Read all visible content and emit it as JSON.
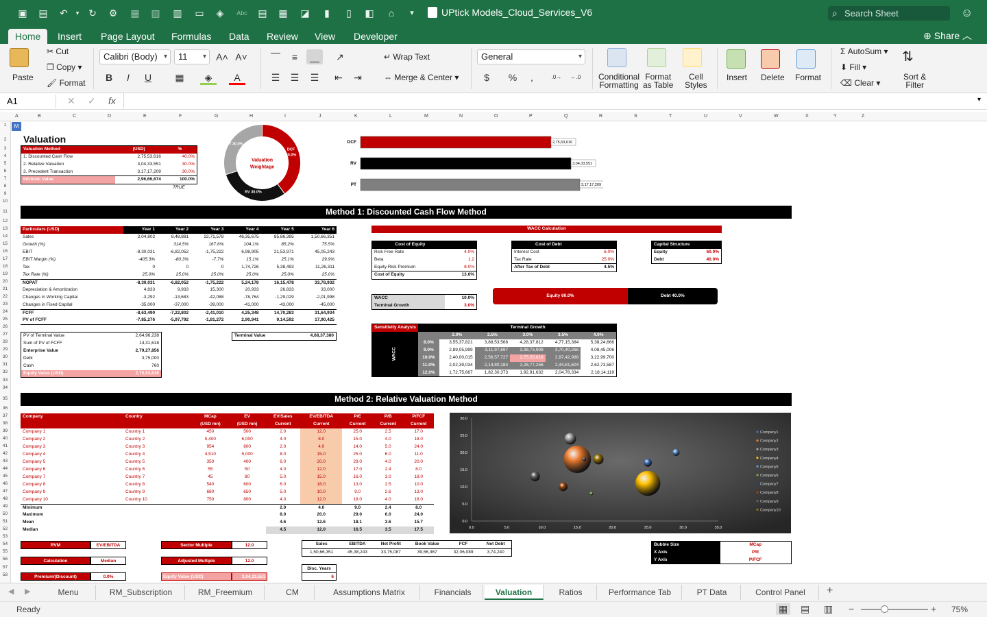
{
  "app": {
    "title": "UPtick Models_Cloud_Services_V6",
    "search_placeholder": "Search Sheet",
    "share": "Share",
    "tabs": [
      "Home",
      "Insert",
      "Page Layout",
      "Formulas",
      "Data",
      "Review",
      "View",
      "Developer"
    ]
  },
  "ribbon": {
    "paste": "Paste",
    "cut": "Cut",
    "copy": "Copy",
    "format": "Format",
    "font": "Calibri (Body)",
    "size": "11",
    "bold": "B",
    "italic": "I",
    "underline": "U",
    "wrap": "Wrap Text",
    "merge": "Merge & Center",
    "numfmt": "General",
    "percent": "%",
    "cond": [
      "Conditional",
      "Formatting"
    ],
    "fmt_table": [
      "Format",
      "as Table"
    ],
    "cell_styles": [
      "Cell",
      "Styles"
    ],
    "insert": "Insert",
    "delete": "Delete",
    "format_cells": "Format",
    "autosum": "AutoSum",
    "fill": "Fill",
    "clear": "Clear",
    "sort": [
      "Sort &",
      "Filter"
    ]
  },
  "formula": {
    "cell": "A1",
    "fx": "fx"
  },
  "columns": [
    "A",
    "B",
    "C",
    "D",
    "E",
    "F",
    "G",
    "H",
    "I",
    "J",
    "K",
    "L",
    "M",
    "N",
    "O",
    "P",
    "Q",
    "R",
    "S",
    "T",
    "U",
    "V",
    "W",
    "X",
    "Y",
    "Z"
  ],
  "valuation": {
    "title": "Valuation",
    "header": [
      "Valuation Method",
      "(USD)",
      "%"
    ],
    "rows": [
      [
        "1. Discounted Cash Flow",
        "2,75,53,616",
        "40.0%"
      ],
      [
        "2. Relative Valuation",
        "3,04,33,551",
        "30.0%"
      ],
      [
        "3. Precedent Transaction",
        "3,17,17,209",
        "30.0%"
      ]
    ],
    "total": [
      "Intrinsic Value",
      "2,96,66,674",
      "100.0%"
    ],
    "check": "TRUE"
  },
  "donut": {
    "center": [
      "Valuation",
      "Weightage"
    ],
    "labels": [
      "DCF",
      "40.0%",
      "RV 30.0%",
      "PT 30.0%"
    ],
    "colors": [
      "#c00000",
      "#111111",
      "#a6a6a6"
    ],
    "values": [
      40,
      30,
      30
    ]
  },
  "bars": {
    "items": [
      {
        "name": "DCF",
        "value": 27553616,
        "label": "2,75,53,616",
        "color": "#c00000"
      },
      {
        "name": "RV",
        "value": 30433551,
        "label": "3,04,33,551",
        "color": "#000000"
      },
      {
        "name": "PT",
        "value": 31717209,
        "label": "3,17,17,209",
        "color": "#7f7f7f"
      }
    ],
    "max": 31717209
  },
  "m1": {
    "title": "Method 1: Discounted Cash Flow Method",
    "head": [
      "Particulars (USD)",
      "Year 1",
      "Year 2",
      "Year 3",
      "Year 4",
      "Year 5",
      "Year 6"
    ],
    "rows": [
      [
        "Sales",
        "2,04,802",
        "8,48,881",
        "22,71,578",
        "46,35,675",
        "85,86,395",
        "1,50,66,351"
      ],
      [
        "Growth (%)",
        "",
        "314.5%",
        "167.6%",
        "104.1%",
        "85.2%",
        "75.5%"
      ],
      [
        "EBIT",
        "-8,30,031",
        "-6,82,052",
        "-1,75,222",
        "6,98,905",
        "21,53,971",
        "45,05,243"
      ],
      [
        "EBIT Margin (%)",
        "-405.3%",
        "-80.3%",
        "-7.7%",
        "15.1%",
        "25.1%",
        "29.9%"
      ],
      [
        "Tax",
        "0",
        "0",
        "0",
        "1,74,726",
        "5,38,493",
        "11,26,311"
      ],
      [
        "Tax Rate (%)",
        "25.0%",
        "25.0%",
        "25.0%",
        "25.0%",
        "25.0%",
        "25.0%"
      ],
      [
        "NOPAT",
        "-8,30,031",
        "-6,82,052",
        "-1,75,222",
        "5,24,178",
        "16,15,478",
        "33,78,932"
      ],
      [
        "Depreciation & Amortization",
        "4,833",
        "9,933",
        "15,300",
        "20,933",
        "26,833",
        "33,000"
      ],
      [
        "Changes in Working Capital",
        "-3,292",
        "-13,683",
        "-42,088",
        "-78,764",
        "-1,29,029",
        "-2,01,998"
      ],
      [
        "Changes in Fixed Capital",
        "-35,000",
        "-37,000",
        "-39,000",
        "-41,000",
        "-43,000",
        "-45,000"
      ],
      [
        "FCFF",
        "-8,63,490",
        "-7,22,802",
        "-2,41,010",
        "4,25,348",
        "14,70,283",
        "31,64,934"
      ],
      [
        "PV of FCFF",
        "-7,85,276",
        "-5,97,792",
        "-1,81,272",
        "2,90,941",
        "9,14,592",
        "17,90,425"
      ]
    ],
    "summary": [
      [
        "PV of Terminal Value",
        "2,64,96,238"
      ],
      [
        "Sum of PV of FCFF",
        "14,31,618"
      ],
      [
        "Enterprise Value",
        "2,79,27,856"
      ],
      [
        "Debt",
        "3,75,000"
      ],
      [
        "Cash",
        "760"
      ],
      [
        "Equity Value (USD)",
        "2,75,53,616"
      ]
    ],
    "terminal": [
      "Terminal Value",
      "4,68,37,380"
    ],
    "wacc_title": "WACC Calculation",
    "coe": {
      "head": "Cost of Equity",
      "rows": [
        [
          "Risk Free Rate",
          "4.0%"
        ],
        [
          "Beta",
          "1.2"
        ],
        [
          "Equity Risk Premium",
          "8.0%"
        ]
      ],
      "total": [
        "Cost of Equity",
        "13.6%"
      ]
    },
    "cod": {
      "head": "Cost of Debt",
      "rows": [
        [
          "Interest Cost",
          "6.0%"
        ],
        [
          "Tax Rate",
          "25.0%"
        ]
      ],
      "total": [
        "After Tax of Debt",
        "4.5%"
      ]
    },
    "cap": {
      "head": "Capital Structure",
      "rows": [
        [
          "Equity",
          "60.0%"
        ],
        [
          "Debt",
          "40.0%"
        ]
      ]
    },
    "wacc": [
      [
        "WACC",
        "10.0%"
      ],
      [
        "Terminal Growth",
        "3.0%"
      ]
    ],
    "equity_bar": {
      "equity_label": "Equity 60.0%",
      "debt_label": "Debt 40.0%",
      "equity": 60
    },
    "sens": {
      "title": "Sensitivity Analysis",
      "tg": "Terminal Growth",
      "wacc": "WACC",
      "cols": [
        "2.0%",
        "2.5%",
        "3.0%",
        "3.5%",
        "4.0%"
      ],
      "rows": [
        [
          "8.0%",
          "3,55,37,821",
          "3,88,53,568",
          "4,28,37,812",
          "4,77,15,384",
          "5,38,24,666"
        ],
        [
          "9.0%",
          "2,89,05,999",
          "3,11,97,697",
          "3,38,73,908",
          "3,70,40,268",
          "4,08,45,006"
        ],
        [
          "10.0%",
          "2,40,00,015",
          "2,56,57,727",
          "2,75,53,616",
          "2,97,42,986",
          "3,22,99,700"
        ],
        [
          "11.0%",
          "2,02,39,034",
          "2,14,80,184",
          "2,28,77,256",
          "2,44,61,604",
          "2,62,73,587"
        ],
        [
          "12.0%",
          "1,72,75,667",
          "1,82,30,373",
          "1,92,91,632",
          "2,04,78,334",
          "2,18,14,119"
        ]
      ]
    }
  },
  "m2": {
    "title": "Method 2: Relative Valuation Method",
    "head": [
      "Company",
      "Country",
      "MCap",
      "EV",
      "EV/Sales",
      "EV/EBITDA",
      "P/E",
      "P/B",
      "P/FCF"
    ],
    "sub": [
      "",
      "",
      "(USD mn)",
      "(USD mn)",
      "Current",
      "Current",
      "Current",
      "Current",
      "Current"
    ],
    "rows": [
      [
        "Company 1",
        "Country 1",
        "450",
        "500",
        "2.0",
        "12.0",
        "25.0",
        "2.5",
        "17.0"
      ],
      [
        "Company 2",
        "Country 2",
        "5,400",
        "6,000",
        "4.0",
        "8.0",
        "15.0",
        "4.0",
        "18.0"
      ],
      [
        "Company 3",
        "Country 3",
        "954",
        "800",
        "2.0",
        "4.0",
        "14.0",
        "5.0",
        "24.0"
      ],
      [
        "Company 4",
        "Country 4",
        "4,510",
        "5,000",
        "8.0",
        "15.0",
        "25.0",
        "6.0",
        "11.0"
      ],
      [
        "Company 5",
        "Country 5",
        "350",
        "400",
        "6.0",
        "20.0",
        "29.0",
        "4.0",
        "20.0"
      ],
      [
        "Company 6",
        "Country 6",
        "55",
        "50",
        "4.0",
        "12.0",
        "17.0",
        "2.4",
        "8.0"
      ],
      [
        "Company 7",
        "Country 7",
        "45",
        "80",
        "5.0",
        "15.0",
        "16.0",
        "3.0",
        "18.0"
      ],
      [
        "Company 8",
        "Country 8",
        "540",
        "600",
        "6.0",
        "18.0",
        "13.0",
        "2.5",
        "10.0"
      ],
      [
        "Company 9",
        "Country 9",
        "680",
        "650",
        "5.0",
        "10.0",
        "9.0",
        "2.6",
        "13.0"
      ],
      [
        "Company 10",
        "Country 10",
        "750",
        "800",
        "4.0",
        "12.0",
        "18.0",
        "4.0",
        "18.0"
      ]
    ],
    "stats": [
      [
        "Minimum",
        "2.0",
        "4.0",
        "9.0",
        "2.4",
        "8.0"
      ],
      [
        "Maximum",
        "8.0",
        "20.0",
        "29.0",
        "6.0",
        "24.0"
      ],
      [
        "Mean",
        "4.6",
        "12.6",
        "18.1",
        "3.6",
        "15.7"
      ],
      [
        "Median",
        "4.5",
        "12.0",
        "16.5",
        "3.5",
        "17.5"
      ]
    ],
    "rvm": [
      "RVM",
      "EV/EBITDA"
    ],
    "calc": [
      "Calculation",
      "Median"
    ],
    "prem": [
      "Premium/(Discount)",
      "0.0%"
    ],
    "sector": [
      "Sector Multiple",
      "12.0"
    ],
    "adjusted": [
      "Adjusted Multiple",
      "12.0"
    ],
    "eqv": [
      "Equity Value (USD)",
      "3,04,33,551"
    ],
    "fin_head": [
      "Sales",
      "EBITDA",
      "Net Profit",
      "Book Value",
      "FCF",
      "Net Debt"
    ],
    "fin_vals": [
      "1,50,66,351",
      "45,38,243",
      "33,75,087",
      "39,56,367",
      "32,06,089",
      "3,74,240"
    ],
    "disc": [
      "Disc. Years",
      "6"
    ],
    "bubble_cfg": [
      [
        "Bubble Size",
        "MCap"
      ],
      [
        "X Axis",
        "P/E"
      ],
      [
        "Y Axis",
        "P/FCF"
      ]
    ]
  },
  "chart_data": {
    "type": "scatter",
    "title": "",
    "xlim": [
      0,
      35
    ],
    "ylim": [
      0,
      30
    ],
    "xticks": [
      "0.0",
      "5.0",
      "10.0",
      "15.0",
      "20.0",
      "25.0",
      "30.0",
      "35.0"
    ],
    "yticks": [
      "0.0",
      "5.0",
      "10.0",
      "15.0",
      "20.0",
      "25.0",
      "30.0"
    ],
    "series": [
      {
        "name": "Company1",
        "x": 25,
        "y": 17,
        "size": 450,
        "color": "#4472c4"
      },
      {
        "name": "Company2",
        "x": 15,
        "y": 18,
        "size": 5400,
        "color": "#ed7d31"
      },
      {
        "name": "Company3",
        "x": 14,
        "y": 24,
        "size": 954,
        "color": "#a5a5a5"
      },
      {
        "name": "Company4",
        "x": 25,
        "y": 11,
        "size": 4510,
        "color": "#ffc000"
      },
      {
        "name": "Company5",
        "x": 29,
        "y": 20,
        "size": 350,
        "color": "#5b9bd5"
      },
      {
        "name": "Company6",
        "x": 17,
        "y": 8,
        "size": 55,
        "color": "#70ad47"
      },
      {
        "name": "Company7",
        "x": 16,
        "y": 18,
        "size": 45,
        "color": "#264478"
      },
      {
        "name": "Company8",
        "x": 13,
        "y": 10,
        "size": 540,
        "color": "#9e480e"
      },
      {
        "name": "Company9",
        "x": 9,
        "y": 13,
        "size": 680,
        "color": "#636363"
      },
      {
        "name": "Company10",
        "x": 18,
        "y": 18,
        "size": 750,
        "color": "#997300"
      }
    ]
  },
  "sheet_tabs": [
    "Menu",
    "RM_Subscription",
    "RM_Freemium",
    "CM",
    "Assumptions Matrix",
    "Financials",
    "Valuation",
    "Ratios",
    "Performance Tab",
    "PT Data",
    "Control Panel"
  ],
  "active_tab": "Valuation",
  "status": {
    "ready": "Ready",
    "zoom": "75%"
  }
}
